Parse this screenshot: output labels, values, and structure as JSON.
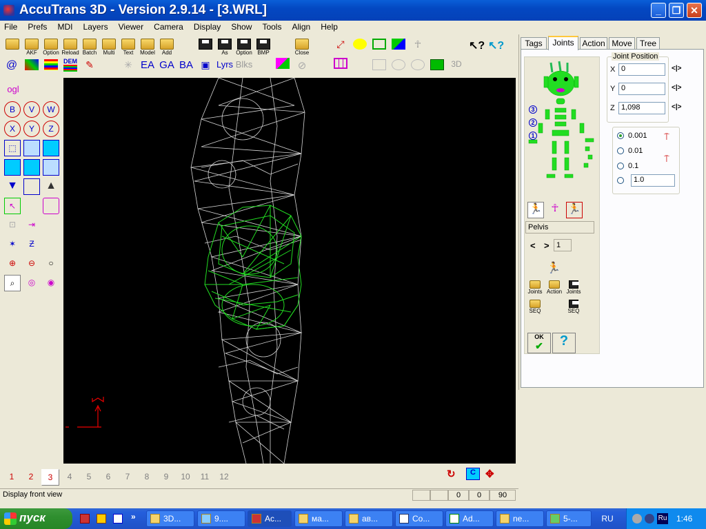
{
  "window": {
    "title": "AccuTrans 3D - Version 2.9.14 - [3.WRL]"
  },
  "menu": [
    "File",
    "Prefs",
    "MDI",
    "Layers",
    "Viewer",
    "Camera",
    "Display",
    "Show",
    "Tools",
    "Align",
    "Help"
  ],
  "toolbar": {
    "row1": [
      "AKF",
      "Option",
      "Reload",
      "Batch",
      "Multi",
      "Text",
      "Model",
      "Add",
      "As",
      "Option",
      "BMP",
      "Close"
    ],
    "row2": [
      "@",
      "DEM",
      "EA",
      "GA",
      "BA",
      "Lyrs",
      "Blks",
      "3D"
    ]
  },
  "left_tools": {
    "ogl": "ogl",
    "b": "B",
    "v": "V",
    "w": "W",
    "x": "X",
    "y": "Y",
    "z": "Z"
  },
  "tabs": [
    "Tags",
    "Joints",
    "Action",
    "Move",
    "Tree"
  ],
  "joint_position": {
    "label": "Joint Position",
    "x_label": "X",
    "x": "0",
    "y_label": "Y",
    "y": "0",
    "z_label": "Z",
    "z": "1,098",
    "nudge": "<|>"
  },
  "step": {
    "options": [
      "0.001",
      "0.01",
      "0.1"
    ],
    "custom": "1.0",
    "selected": "0.001"
  },
  "figure_levels": [
    "3",
    "2",
    "1"
  ],
  "joint_name": "Pelvis",
  "joint_index": "1",
  "nav": {
    "prev": "<",
    "next": ">"
  },
  "file_buttons": [
    "Joints",
    "Action",
    "Joints",
    "SEQ",
    "SEQ"
  ],
  "ok_label": "OK",
  "help_label": "?",
  "viewport_numbers": [
    "1",
    "2",
    "3",
    "4",
    "5",
    "6",
    "7",
    "8",
    "9",
    "10",
    "11",
    "12"
  ],
  "status": {
    "text": "Display front view",
    "v1": "0",
    "v2": "0",
    "v3": "90"
  },
  "taskbar": {
    "start": "пуск",
    "tasks": [
      "3D...",
      "9....",
      "Ac...",
      "ма...",
      "ав...",
      "Co...",
      "Ad...",
      "ne...",
      "5-..."
    ],
    "lang": "RU",
    "tray_lang": "Ru",
    "clock": "1:46"
  },
  "colors": {
    "titlebar": "#0348c2",
    "selection": "#00ff00",
    "wireframe": "#d8d8d8"
  }
}
